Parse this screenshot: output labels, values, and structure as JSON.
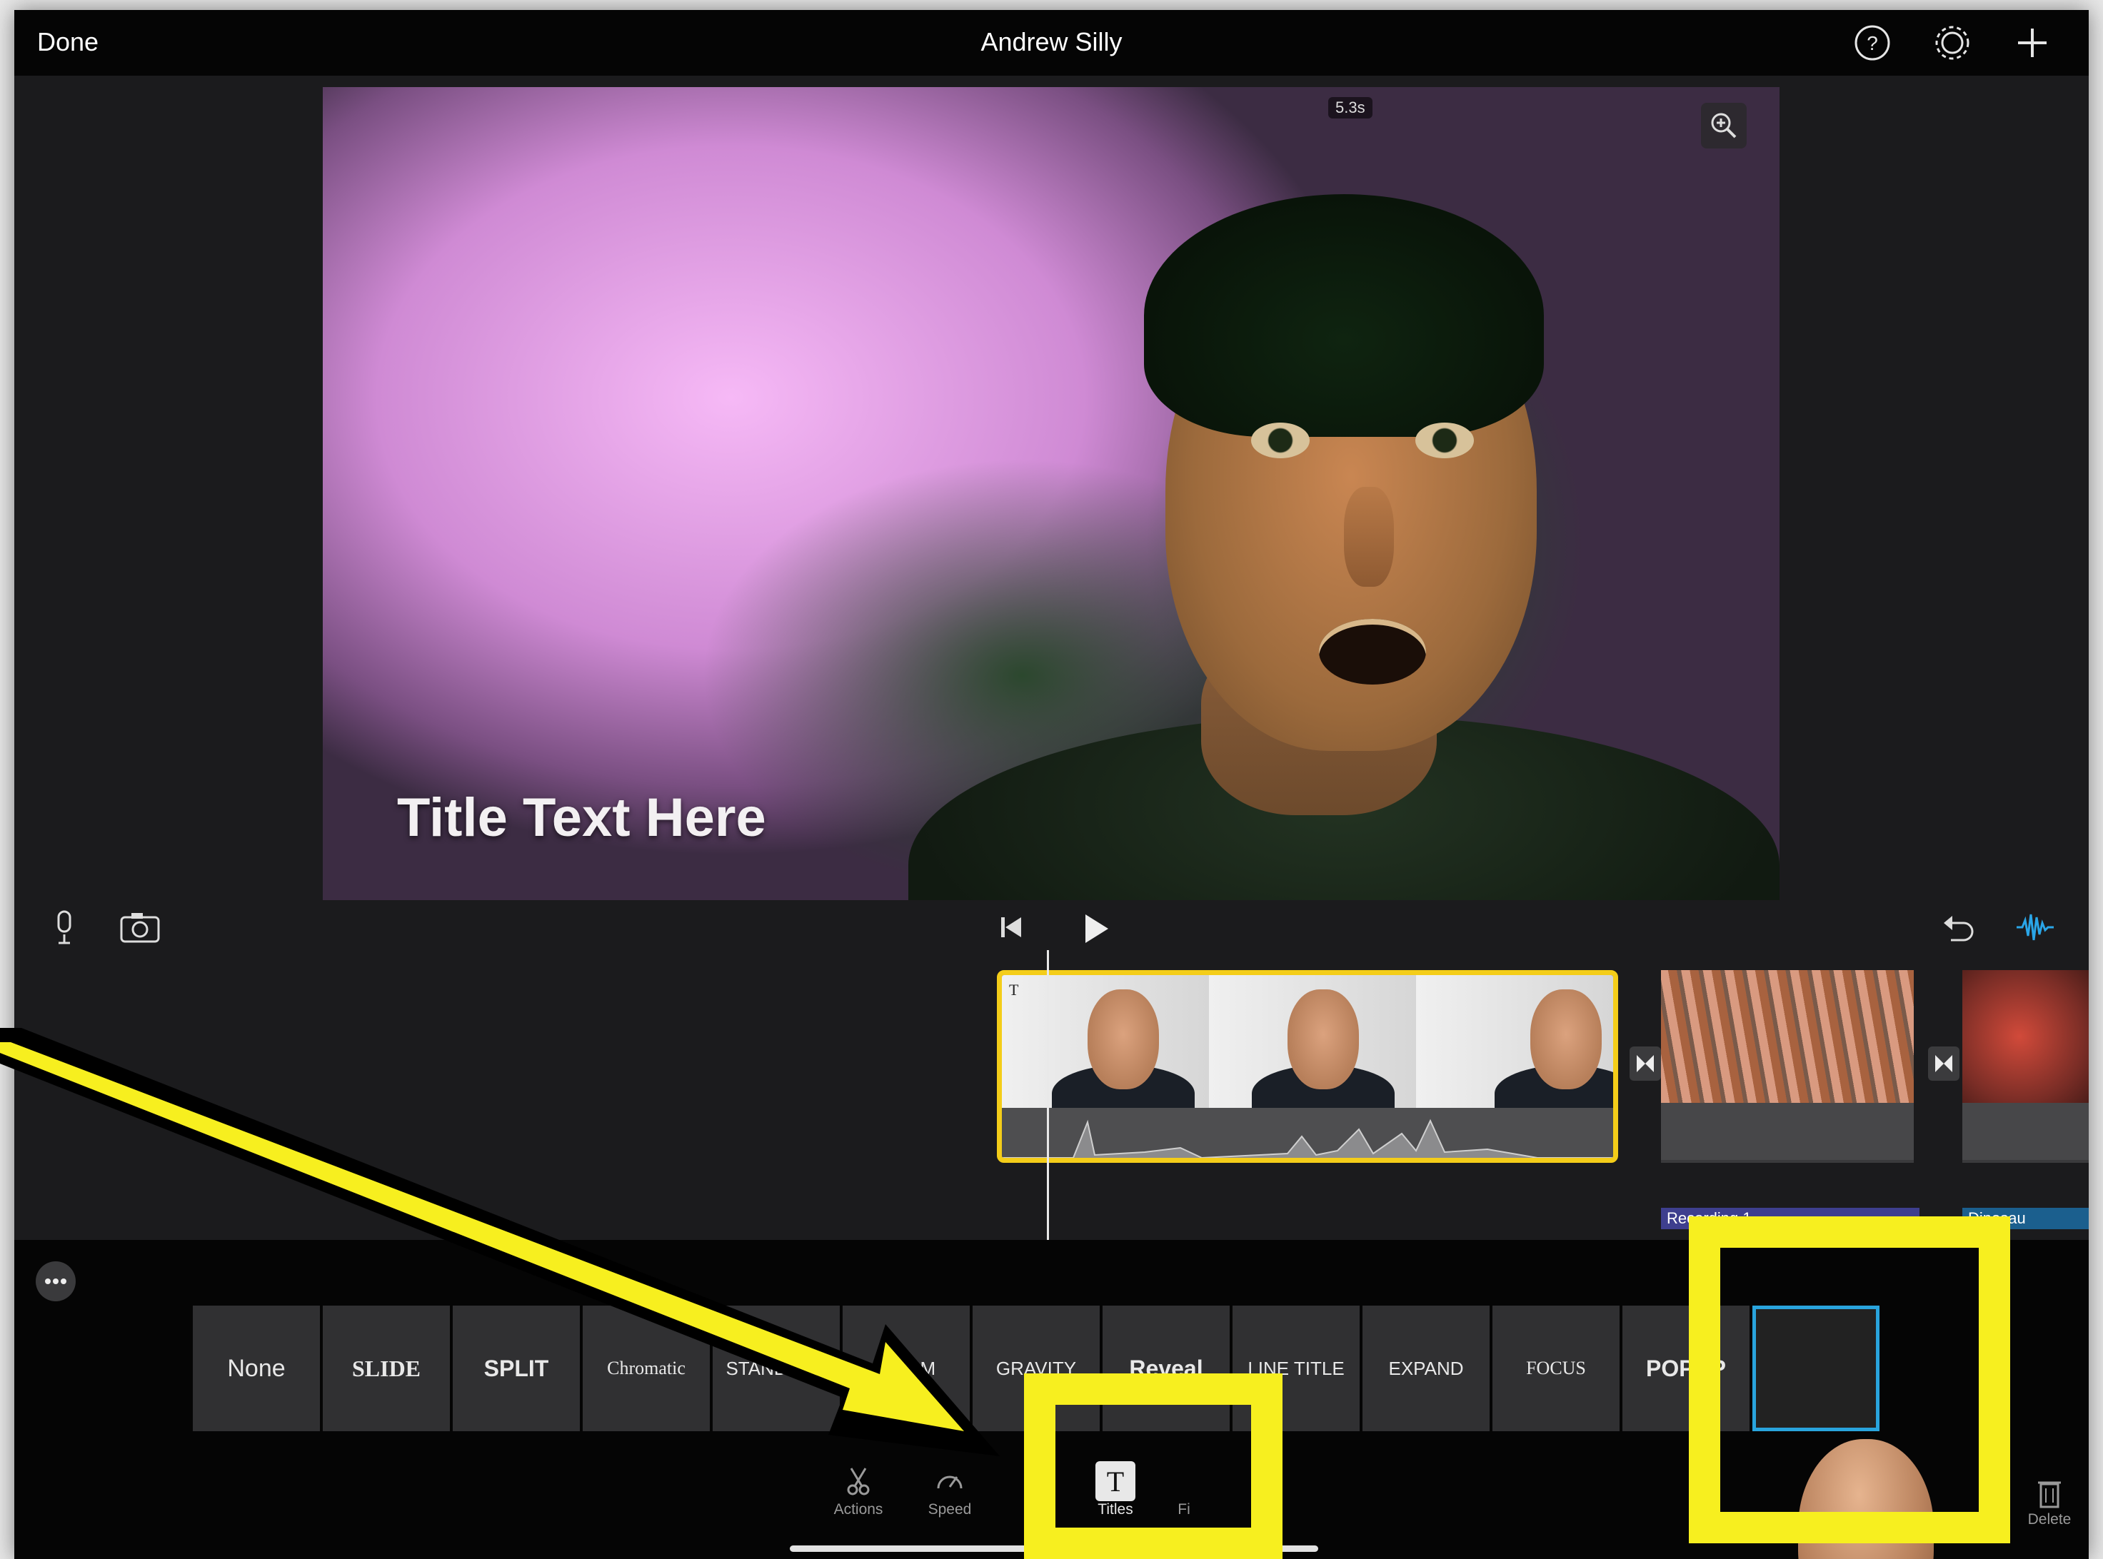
{
  "header": {
    "done_label": "Done",
    "project_title": "Andrew Silly"
  },
  "preview": {
    "time_badge": "5.3s",
    "title_text": "Title Text Here"
  },
  "timeline": {
    "label_recording": "Recording 1",
    "label_dinosaur": "Dinosau"
  },
  "title_styles": [
    {
      "label": "None"
    },
    {
      "label": "SLIDE"
    },
    {
      "label": "SPLIT"
    },
    {
      "label": "Chromatic"
    },
    {
      "label": "STANDARD"
    },
    {
      "label": "PRISM"
    },
    {
      "label": "GRAVITY"
    },
    {
      "label": "Reveal"
    },
    {
      "label": "LINE TITLE"
    },
    {
      "label": "EXPAND"
    },
    {
      "label": "FOCUS"
    },
    {
      "label": "POPUP"
    },
    {
      "label": ""
    }
  ],
  "tools": {
    "actions": "Actions",
    "speed": "Speed",
    "titles": "Titles",
    "filters": "Fi",
    "delete": "Delete"
  },
  "colors": {
    "accent_yellow": "#f4cd19",
    "selection_blue": "#29a4dd",
    "annotation_yellow": "#f7ef1f"
  }
}
